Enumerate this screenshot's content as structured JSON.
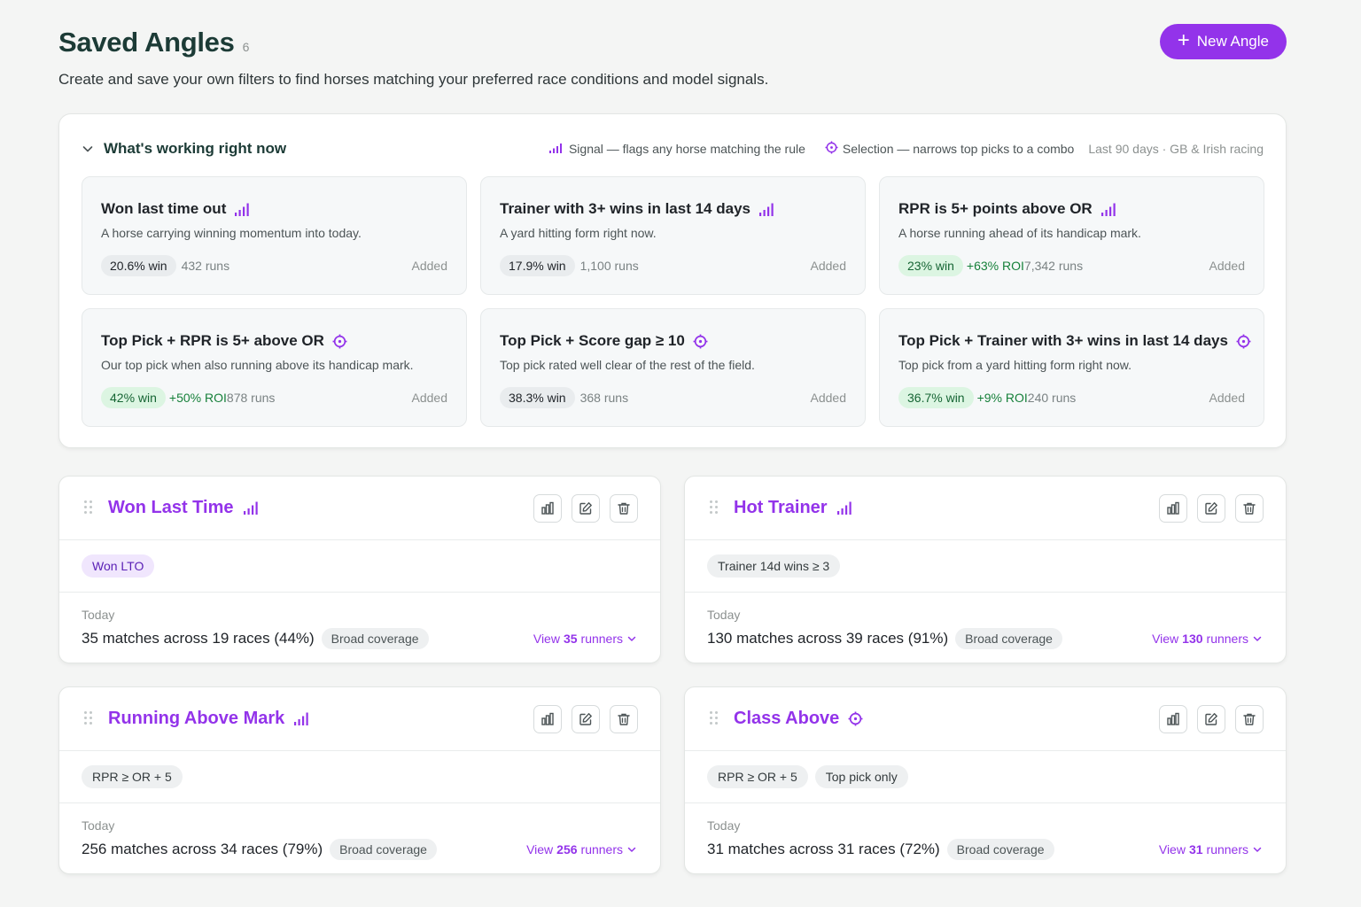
{
  "header": {
    "title": "Saved Angles",
    "count": "6",
    "subtitle": "Create and save your own filters to find horses matching your preferred race conditions and model signals.",
    "new_button": "New Angle"
  },
  "working": {
    "title": "What's working right now",
    "legend_signal": "Signal — flags any horse matching the rule",
    "legend_selection": "Selection — narrows top picks to a combo",
    "range": "Last 90 days · GB & Irish racing",
    "cards": [
      {
        "title": "Won last time out",
        "kind": "signal",
        "desc": "A horse carrying winning momentum into today.",
        "win": "20.6% win",
        "good": false,
        "roi": "",
        "runs": "432 runs",
        "status": "Added"
      },
      {
        "title": "Trainer with 3+ wins in last 14 days",
        "kind": "signal",
        "desc": "A yard hitting form right now.",
        "win": "17.9% win",
        "good": false,
        "roi": "",
        "runs": "1,100 runs",
        "status": "Added"
      },
      {
        "title": "RPR is 5+ points above OR",
        "kind": "signal",
        "desc": "A horse running ahead of its handicap mark.",
        "win": "23% win",
        "good": true,
        "roi": "+63% ROI",
        "runs": "7,342 runs",
        "status": "Added"
      },
      {
        "title": "Top Pick + RPR is 5+ above OR",
        "kind": "selection",
        "desc": "Our top pick when also running above its handicap mark.",
        "win": "42% win",
        "good": true,
        "roi": "+50% ROI",
        "runs": "878 runs",
        "status": "Added"
      },
      {
        "title": "Top Pick + Score gap ≥ 10",
        "kind": "selection",
        "desc": "Top pick rated well clear of the rest of the field.",
        "win": "38.3% win",
        "good": false,
        "roi": "",
        "runs": "368 runs",
        "status": "Added"
      },
      {
        "title": "Top Pick + Trainer with 3+ wins in last 14 days",
        "kind": "selection",
        "desc": "Top pick from a yard hitting form right now.",
        "win": "36.7% win",
        "good": true,
        "roi": "+9% ROI",
        "runs": "240 runs",
        "status": "Added"
      }
    ]
  },
  "angles": [
    {
      "title": "Won Last Time",
      "kind": "signal",
      "tags": [
        {
          "label": "Won LTO",
          "purple": true
        }
      ],
      "today": "Today",
      "matches": "35 matches across 19 races (44%)",
      "coverage": "Broad coverage",
      "view_prefix": "View",
      "view_count": "35",
      "view_suffix": "runners"
    },
    {
      "title": "Hot Trainer",
      "kind": "signal",
      "tags": [
        {
          "label": "Trainer 14d wins ≥ 3",
          "purple": false
        }
      ],
      "today": "Today",
      "matches": "130 matches across 39 races (91%)",
      "coverage": "Broad coverage",
      "view_prefix": "View",
      "view_count": "130",
      "view_suffix": "runners"
    },
    {
      "title": "Running Above Mark",
      "kind": "signal",
      "tags": [
        {
          "label": "RPR ≥ OR + 5",
          "purple": false
        }
      ],
      "today": "Today",
      "matches": "256 matches across 34 races (79%)",
      "coverage": "Broad coverage",
      "view_prefix": "View",
      "view_count": "256",
      "view_suffix": "runners"
    },
    {
      "title": "Class Above",
      "kind": "selection",
      "tags": [
        {
          "label": "RPR ≥ OR + 5",
          "purple": false
        },
        {
          "label": "Top pick only",
          "purple": false
        }
      ],
      "today": "Today",
      "matches": "31 matches across 31 races (72%)",
      "coverage": "Broad coverage",
      "view_prefix": "View",
      "view_count": "31",
      "view_suffix": "runners"
    }
  ],
  "colors": {
    "accent": "#9333ea",
    "heading": "#1c3b36",
    "positive": "#16803a"
  }
}
